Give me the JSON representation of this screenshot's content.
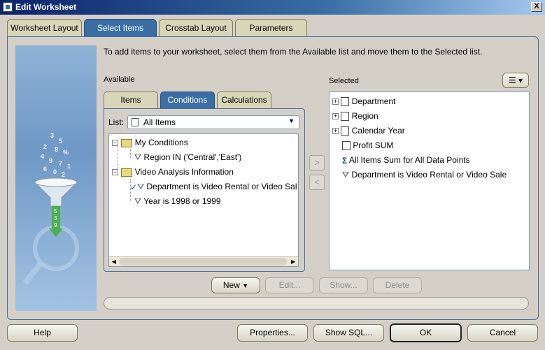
{
  "window": {
    "title": "Edit Worksheet",
    "close_glyph": "X"
  },
  "tabs": [
    {
      "label": "Worksheet Layout",
      "active": false
    },
    {
      "label": "Select Items",
      "active": true
    },
    {
      "label": "Crosstab Layout",
      "active": false
    },
    {
      "label": "Parameters",
      "active": false
    }
  ],
  "instruction": "To add items to your worksheet, select them from the Available list and move them to the Selected list.",
  "available": {
    "label": "Available",
    "subtabs": [
      {
        "label": "Items",
        "active": false
      },
      {
        "label": "Conditions",
        "active": true
      },
      {
        "label": "Calculations",
        "active": false
      }
    ],
    "list_label": "List:",
    "list_value": "All Items",
    "tree": [
      {
        "label": "My Conditions",
        "expander": "-"
      },
      {
        "label": "Region IN ('Central','East')"
      },
      {
        "label": "Video Analysis Information",
        "expander": "-"
      },
      {
        "label": "Department is Video Rental or Video Sal",
        "checked": true
      },
      {
        "label": "Year is 1998 or 1999"
      }
    ]
  },
  "move": {
    "add_glyph": ">",
    "remove_glyph": "<"
  },
  "selected": {
    "label": "Selected",
    "items": [
      {
        "label": "Department",
        "expander": "+"
      },
      {
        "label": "Region",
        "expander": "+"
      },
      {
        "label": "Calendar Year",
        "expander": "+"
      },
      {
        "label": "Profit SUM"
      },
      {
        "label": "All Items Sum for All Data Points"
      },
      {
        "label": "Department is Video Rental or Video Sale"
      }
    ]
  },
  "actions": {
    "new": "New",
    "edit": "Edit...",
    "show": "Show...",
    "delete": "Delete"
  },
  "footer": {
    "help": "Help",
    "properties": "Properties...",
    "show_sql": "Show SQL...",
    "ok": "OK",
    "cancel": "Cancel"
  },
  "colors": {
    "accent": "#3a6ea5",
    "tab": "#d8d6b8",
    "face": "#d4d0c8"
  }
}
